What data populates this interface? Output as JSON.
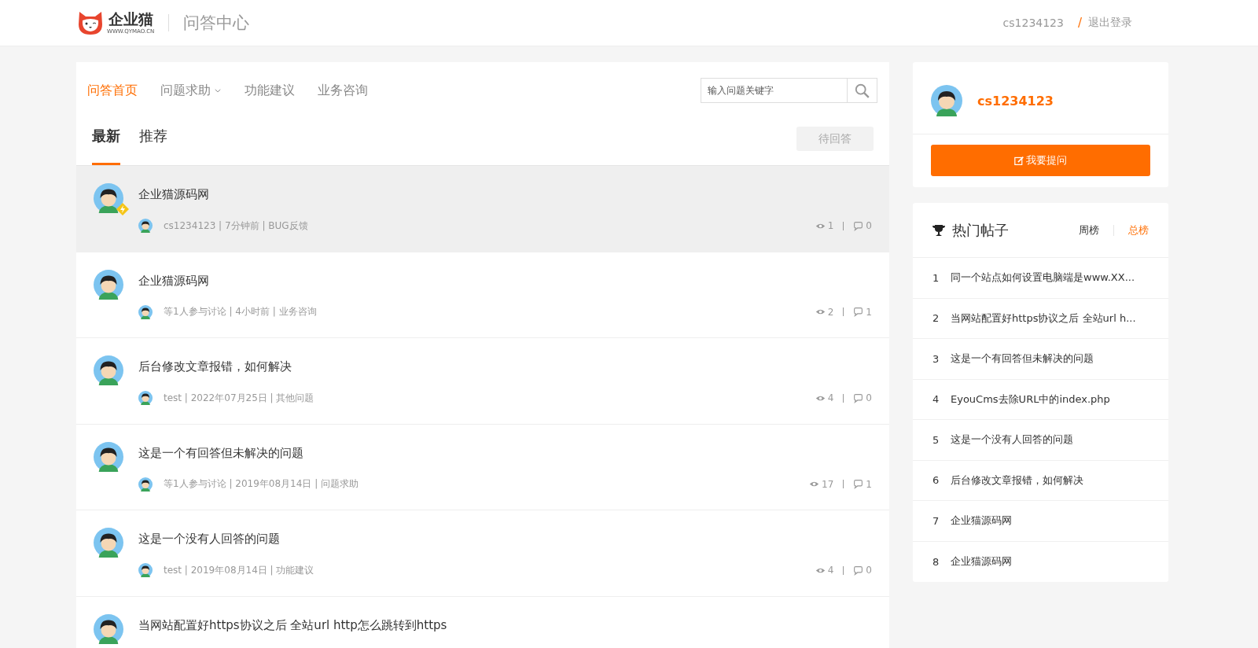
{
  "header": {
    "logo": {
      "name": "企业猫",
      "url": "WWW.QYMAO.CN"
    },
    "title": "问答中心",
    "user": "cs1234123",
    "separator": "/",
    "logout": "退出登录"
  },
  "nav": [
    {
      "label": "问答首页",
      "selected": true,
      "kind": "link"
    },
    {
      "label": "问题求助",
      "selected": false,
      "kind": "dropdown"
    },
    {
      "label": "功能建议",
      "selected": false,
      "kind": "link"
    },
    {
      "label": "业务咨询",
      "selected": false,
      "kind": "link"
    }
  ],
  "search": {
    "placeholder": "输入问题关键字"
  },
  "tabs": [
    {
      "label": "最新",
      "selected": true
    },
    {
      "label": "推荐",
      "selected": false
    }
  ],
  "filter_button": "待回答",
  "questions": [
    {
      "title": "企业猫源码网",
      "badge": true,
      "highlighted": true,
      "meta": "cs1234123 | 7分钟前 | BUG反馈",
      "views": "1",
      "answers": "0"
    },
    {
      "title": "企业猫源码网",
      "badge": false,
      "highlighted": false,
      "meta": "等1人参与讨论 | 4小时前 | 业务咨询",
      "views": "2",
      "answers": "1"
    },
    {
      "title": "后台修改文章报错，如何解决",
      "badge": false,
      "highlighted": false,
      "meta": "test | 2022年07月25日 | 其他问题",
      "views": "4",
      "answers": "0"
    },
    {
      "title": "这是一个有回答但未解决的问题",
      "badge": false,
      "highlighted": false,
      "meta": "等1人参与讨论 | 2019年08月14日 | 问题求助",
      "views": "17",
      "answers": "1"
    },
    {
      "title": "这是一个没有人回答的问题",
      "badge": false,
      "highlighted": false,
      "meta": "test | 2019年08月14日 | 功能建议",
      "views": "4",
      "answers": "0"
    },
    {
      "title": "当网站配置好https协议之后 全站url http怎么跳转到https",
      "badge": false,
      "highlighted": false
    }
  ],
  "profile": {
    "username": "cs1234123",
    "ask_button": "我要提问"
  },
  "hot_posts": {
    "title": "热门帖子",
    "periods": [
      {
        "label": "周榜",
        "selected": false
      },
      {
        "label": "总榜",
        "selected": true
      }
    ],
    "items": [
      {
        "rank": "1",
        "title": "同一个站点如何设置电脑端是www.XX..."
      },
      {
        "rank": "2",
        "title": "当网站配置好https协议之后 全站url h..."
      },
      {
        "rank": "3",
        "title": "这是一个有回答但未解决的问题"
      },
      {
        "rank": "4",
        "title": "EyouCms去除URL中的index.php"
      },
      {
        "rank": "5",
        "title": "这是一个没有人回答的问题"
      },
      {
        "rank": "6",
        "title": "后台修改文章报错，如何解决"
      },
      {
        "rank": "7",
        "title": "企业猫源码网"
      },
      {
        "rank": "8",
        "title": "企业猫源码网"
      }
    ]
  }
}
